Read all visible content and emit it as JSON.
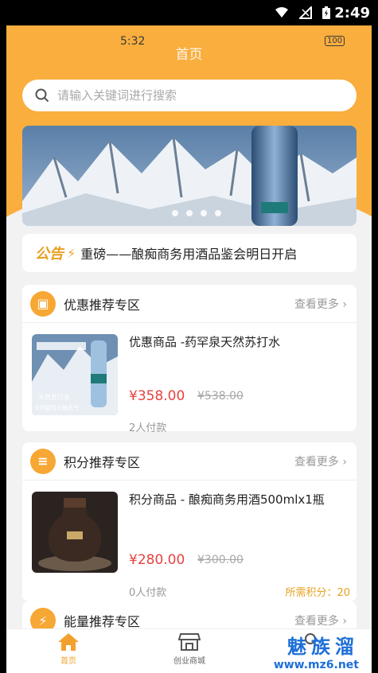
{
  "system_status": {
    "time": "2:49"
  },
  "inner_status": {
    "time": "5:32",
    "battery": "100"
  },
  "header": {
    "title": "首页"
  },
  "search": {
    "placeholder": "请输入关键词进行搜索"
  },
  "banner": {
    "slide_count": 4,
    "active_slide": 1
  },
  "notice": {
    "logo": "公告",
    "text": "重磅——酿痴商务用酒品鉴会明日开启"
  },
  "sections": [
    {
      "title": "优惠推荐专区",
      "more": "查看更多",
      "icon": "ticket-icon",
      "product": {
        "name": "优惠商品 -药罕泉天然苏打水",
        "price": "¥358.00",
        "old_price": "¥538.00",
        "sold": "2人付款",
        "image_caption_1": "天然苏打水",
        "image_caption_2": "天然碱性天糖无气"
      }
    },
    {
      "title": "积分推荐专区",
      "more": "查看更多",
      "icon": "coins-icon",
      "product": {
        "name": "积分商品 - 酿痴商务用酒500mlx1瓶",
        "price": "¥280.00",
        "old_price": "¥300.00",
        "sold": "0人付款",
        "points": "所需积分：20"
      }
    },
    {
      "title": "能量推荐专区",
      "more": "查看更多",
      "icon": "lightning-icon"
    }
  ],
  "bottom_nav": [
    {
      "label": "首页",
      "active": true,
      "icon": "home-icon"
    },
    {
      "label": "创业商城",
      "active": false,
      "icon": "shop-icon"
    },
    {
      "label": "",
      "active": false,
      "icon": "profile-icon"
    }
  ],
  "watermark": {
    "brand": "魅族溜",
    "url": "www.mz6.net"
  },
  "colors": {
    "accent": "#f9ae3e",
    "price": "#e64340",
    "points": "#e8a020"
  }
}
